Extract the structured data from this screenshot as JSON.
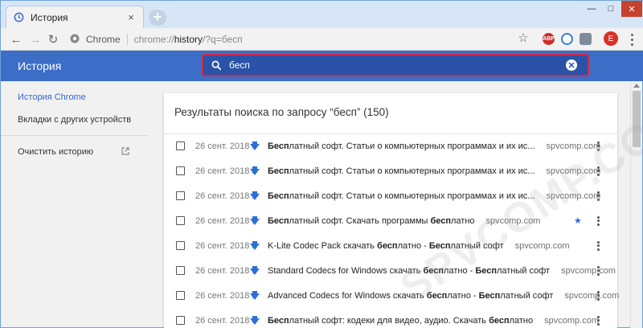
{
  "window": {
    "tab_title": "История",
    "tab_close": "×",
    "new_tab": "+",
    "controls": {
      "minimize": "—",
      "maximize": "□",
      "close": "✕"
    }
  },
  "toolbar": {
    "back": "←",
    "forward": "→",
    "reload": "↻",
    "site_name": "Chrome",
    "url_prefix": "chrome://",
    "url_bold": "history",
    "url_suffix": "/?q=бесп",
    "star": "☆",
    "abp_label": "ABP",
    "avatar_letter": "E"
  },
  "header": {
    "title": "История",
    "search_value": "бесп"
  },
  "sidebar": {
    "items": [
      {
        "label": "История Chrome"
      },
      {
        "label": "Вкладки с других устройств"
      },
      {
        "label": "Очистить историю"
      }
    ]
  },
  "main": {
    "results_title": "Результаты поиска по запросу “бесп” (150)",
    "rows": [
      {
        "date": "26 сент. 2018 г.",
        "bold": "Бесп",
        "rest": "латный софт. Статьи о компьютерных программах и их ис...",
        "extra_bold": "",
        "extra_rest": "",
        "domain": "spvcomp.com",
        "starred": false
      },
      {
        "date": "26 сент. 2018 г.",
        "bold": "Бесп",
        "rest": "латный софт. Статьи о компьютерных программах и их ис...",
        "extra_bold": "",
        "extra_rest": "",
        "domain": "spvcomp.com",
        "starred": false
      },
      {
        "date": "26 сент. 2018 г.",
        "bold": "Бесп",
        "rest": "латный софт. Статьи о компьютерных программах и их ис...",
        "extra_bold": "",
        "extra_rest": "",
        "domain": "spvcomp.com",
        "starred": false
      },
      {
        "date": "26 сент. 2018 г.",
        "bold": "Бесп",
        "rest": "латный софт. Скачать программы ",
        "extra_bold": "бесп",
        "extra_rest": "латно",
        "domain": "spvcomp.com",
        "starred": true
      },
      {
        "date": "26 сент. 2018 г.",
        "pre": "K-Lite Codec Pack скачать ",
        "bold": "бесп",
        "rest": "латно - ",
        "extra_bold": "Бесп",
        "extra_rest": "латный софт",
        "domain": "spvcomp.com",
        "starred": false
      },
      {
        "date": "26 сент. 2018 г.",
        "pre": "Standard Codecs for Windows скачать ",
        "bold": "бесп",
        "rest": "латно - ",
        "extra_bold": "Бесп",
        "extra_rest": "латный софт",
        "domain": "spvcomp.com",
        "starred": false
      },
      {
        "date": "26 сент. 2018 г.",
        "pre": "Advanced Codecs for Windows скачать ",
        "bold": "бесп",
        "rest": "латно - ",
        "extra_bold": "Бесп",
        "extra_rest": "латный софт",
        "domain": "spvcomp.com",
        "starred": false
      },
      {
        "date": "26 сент. 2018 г.",
        "bold": "Бесп",
        "rest": "латный софт: кодеки для видео, аудио. Скачать ",
        "extra_bold": "бесп",
        "extra_rest": "латно",
        "domain": "spvcomp.com",
        "starred": false
      }
    ]
  },
  "watermark": "SPVCOMP.COM",
  "colors": {
    "header_bg": "#3c6dc7",
    "search_highlight": "#d2294a",
    "active_link": "#3367d6"
  }
}
